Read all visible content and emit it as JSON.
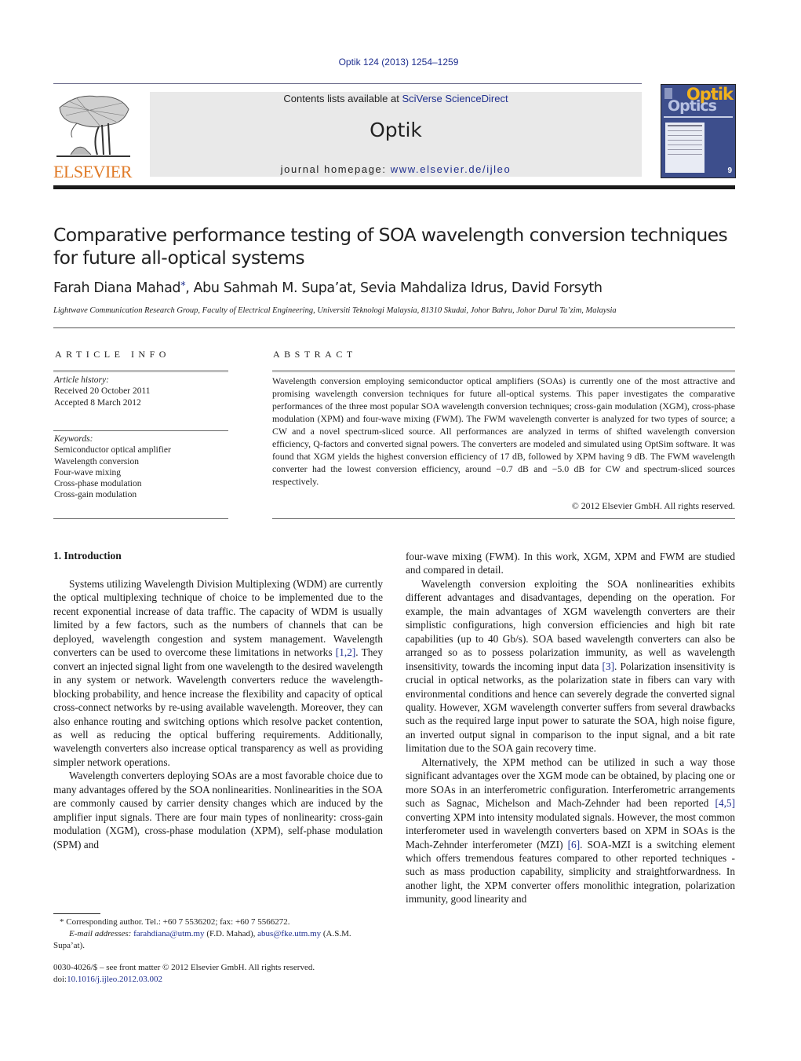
{
  "header": {
    "citation": "Optik 124 (2013) 1254–1259",
    "contents_prefix": "Contents lists available at ",
    "contents_link": "SciVerse ScienceDirect",
    "journal_name": "Optik",
    "homepage_prefix": "journal homepage: ",
    "homepage_link": "www.elsevier.de/ijleo",
    "publisher_wordmark": "ELSEVIER",
    "cover": {
      "title_top": "Optik",
      "title_bottom": "Optics",
      "issue": "9"
    },
    "colors": {
      "link": "#1f2f8f",
      "publisher_orange": "#e07b28",
      "cover_blue": "#3d4e8c",
      "cover_yellow": "#f2b21b",
      "banner_gray": "#e9e9e9"
    }
  },
  "article": {
    "title": "Comparative performance testing of SOA wavelength conversion techniques for future all-optical systems",
    "authors": "Farah Diana Mahad",
    "authors_star": "*",
    "authors_rest": ", Abu Sahmah M. Supa’at, Sevia Mahdaliza Idrus, David Forsyth",
    "affiliation": "Lightwave Communication Research Group, Faculty of Electrical Engineering, Universiti Teknologi Malaysia, 81310 Skudai, Johor Bahru, Johor Darul Ta’zim, Malaysia"
  },
  "article_info": {
    "heading": "ARTICLE INFO",
    "history_label": "Article history:",
    "received": "Received 20 October 2011",
    "accepted": "Accepted 8 March 2012",
    "keywords_label": "Keywords:",
    "keywords": [
      "Semiconductor optical amplifier",
      "Wavelength conversion",
      "Four-wave mixing",
      "Cross-phase modulation",
      "Cross-gain modulation"
    ]
  },
  "abstract": {
    "heading": "ABSTRACT",
    "text": "Wavelength conversion employing semiconductor optical amplifiers (SOAs) is currently one of the most attractive and promising wavelength conversion techniques for future all-optical systems. This paper investigates the comparative performances of the three most popular SOA wavelength conversion techniques; cross-gain modulation (XGM), cross-phase modulation (XPM) and four-wave mixing (FWM). The FWM wavelength converter is analyzed for two types of source; a CW and a novel spectrum-sliced source. All performances are analyzed in terms of shifted wavelength conversion efficiency, Q-factors and converted signal powers. The converters are modeled and simulated using OptSim software. It was found that XGM yields the highest conversion efficiency of 17 dB, followed by XPM having 9 dB. The FWM wavelength converter had the lowest conversion efficiency, around −0.7 dB and −5.0 dB for CW and spectrum-sliced sources respectively.",
    "copyright": "© 2012 Elsevier GmbH. All rights reserved."
  },
  "body": {
    "intro_heading": "1.  Introduction",
    "left": {
      "p1_a": "Systems utilizing Wavelength Division Multiplexing (WDM) are currently the optical multiplexing technique of choice to be implemented due to the recent exponential increase of data traffic. The capacity of WDM is usually limited by a few factors, such as the numbers of channels that can be deployed, wavelength congestion and system management. Wavelength converters can be used to overcome these limitations in networks ",
      "p1_ref": "[1,2]",
      "p1_b": ". They convert an injected signal light from one wavelength to the desired wavelength in any system or network. Wavelength converters reduce the wavelength-blocking probability, and hence increase the flexibility and capacity of optical cross-connect networks by re-using available wavelength. Moreover, they can also enhance routing and switching options which resolve packet contention, as well as reducing the optical buffering requirements. Additionally, wavelength converters also increase optical transparency as well as providing simpler network operations.",
      "p2": "Wavelength converters deploying SOAs are a most favorable choice due to many advantages offered by the SOA nonlinearities. Nonlinearities in the SOA are commonly caused by carrier density changes which are induced by the amplifier input signals. There are four main types of nonlinearity: cross-gain modulation (XGM), cross-phase modulation (XPM), self-phase modulation (SPM) and"
    },
    "right": {
      "p0": "four-wave mixing (FWM). In this work, XGM, XPM and FWM are studied and compared in detail.",
      "p1_a": "Wavelength conversion exploiting the SOA nonlinearities exhibits different advantages and disadvantages, depending on the operation. For example, the main advantages of XGM wavelength converters are their simplistic configurations, high conversion efficiencies and high bit rate capabilities (up to 40 Gb/s). SOA based wavelength converters can also be arranged so as to possess polarization immunity, as well as wavelength insensitivity, towards the incoming input data ",
      "p1_ref": "[3]",
      "p1_b": ". Polarization insensitivity is crucial in optical networks, as the polarization state in fibers can vary with environmental conditions and hence can severely degrade the converted signal quality. However, XGM wavelength converter suffers from several drawbacks such as the required large input power to saturate the SOA, high noise figure, an inverted output signal in comparison to the input signal, and a bit rate limitation due to the SOA gain recovery time.",
      "p2_a": "Alternatively, the XPM method can be utilized in such a way those significant advantages over the XGM mode can be obtained, by placing one or more SOAs in an interferometric configuration. Interferometric arrangements such as Sagnac, Michelson and Mach-Zehnder had been reported ",
      "p2_ref1": "[4,5]",
      "p2_b": " converting XPM into intensity modulated signals. However, the most common interferometer used in wavelength converters based on XPM in SOAs is the Mach-Zehnder interferometer (MZI) ",
      "p2_ref2": "[6]",
      "p2_c": ". SOA-MZI is a switching element which offers tremendous features compared to other reported techniques - such as mass production capability, simplicity and straightforwardness. In another light, the XPM converter offers monolithic integration, polarization immunity, good linearity and"
    }
  },
  "footnote": {
    "star": "*",
    "corresponding": " Corresponding author. Tel.: +60 7 5536202; fax: +60 7 5566272.",
    "email_label": "E-mail addresses:",
    "email1": "farahdiana@utm.my",
    "email1_owner": " (F.D. Mahad), ",
    "email2": "abus@fke.utm.my",
    "email2_owner": " (A.S.M. Supa’at)."
  },
  "frontmatter": {
    "issn_line": "0030-4026/$ – see front matter © 2012 Elsevier GmbH. All rights reserved.",
    "doi_prefix": "doi:",
    "doi": "10.1016/j.ijleo.2012.03.002"
  }
}
